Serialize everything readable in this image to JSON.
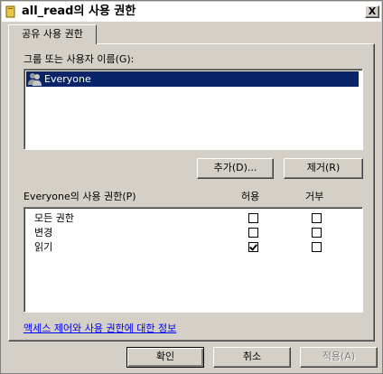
{
  "window": {
    "title": "all_read의 사용 권한",
    "close_label": "X"
  },
  "tab": {
    "label": "공유 사용 권한"
  },
  "group_section": {
    "label": "그룹 또는 사용자 이름(G):",
    "users": [
      {
        "name": "Everyone",
        "icon": "users-group-icon"
      }
    ],
    "add_button": "추가(D)...",
    "remove_button": "제거(R)"
  },
  "permissions_section": {
    "label": "Everyone의 사용 권한(P)",
    "allow_header": "허용",
    "deny_header": "거부",
    "rows": [
      {
        "name": "모든 권한",
        "allow": false,
        "deny": false
      },
      {
        "name": "변경",
        "allow": false,
        "deny": false
      },
      {
        "name": "읽기",
        "allow": true,
        "deny": false
      }
    ]
  },
  "info_link": "액세스 제어와 사용 권한에 대한 정보",
  "buttons": {
    "ok": "확인",
    "cancel": "취소",
    "apply": "적용(A)"
  }
}
